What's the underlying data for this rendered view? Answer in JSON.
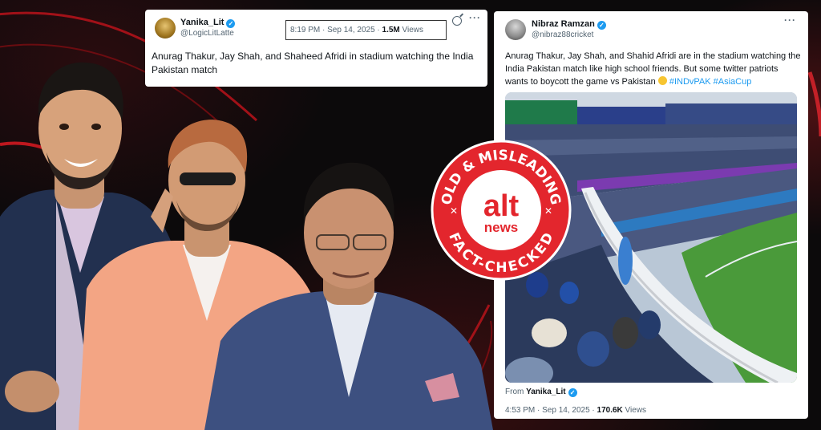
{
  "tweet1": {
    "name": "Yanika_Lit",
    "handle": "@LogicLitLatte",
    "time": "8:19 PM · Sep 14, 2025 · ",
    "views": "1.5M",
    "views_label": " Views",
    "more": "···",
    "text": "Anurag Thakur, Jay Shah, and Shaheed Afridi in stadium watching the India Pakistan match"
  },
  "tweet2": {
    "name": "Nibraz Ramzan",
    "handle": "@nibraz88cricket",
    "more": "···",
    "text": "Anurag Thakur, Jay Shah, and Shahid Afridi are in the stadium watching the India Pakistan match like high school friends. But some twitter patriots wants to boycott the game vs Pakistan",
    "hashtags": "#INDvPAK #AsiaCup",
    "from_label": "From ",
    "from_name": "Yanika_Lit",
    "time": "4:53 PM · Sep 14, 2025 · ",
    "views": "170.6K",
    "views_label": " Views"
  },
  "badge": {
    "top_text": "OLD & MISLEADING",
    "bottom_text": "FACT-CHECKED",
    "brand_top": "alt",
    "brand_bottom": "news"
  },
  "colors": {
    "badge_red": "#e3262d",
    "verified": "#1d9bf0",
    "hashtag": "#1d9bf0",
    "background": "#0c0a0b"
  }
}
